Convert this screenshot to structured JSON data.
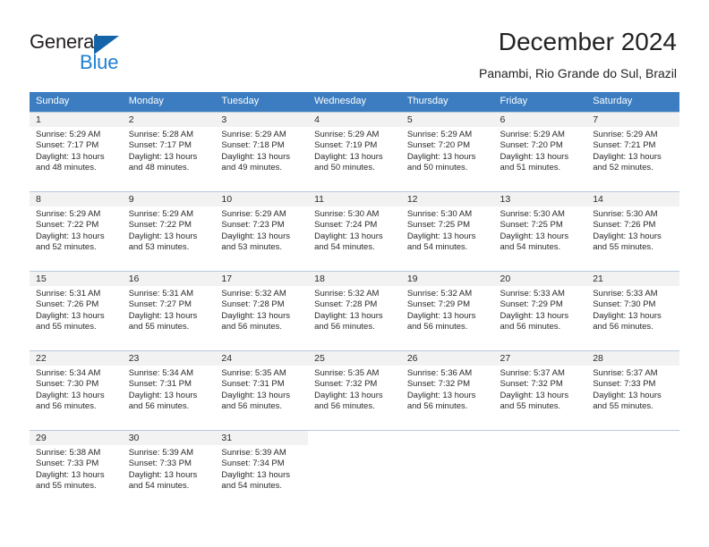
{
  "brand": {
    "name_part1": "General",
    "name_part2": "Blue",
    "accent_color": "#1f7fd4",
    "triangle_color": "#1464aa"
  },
  "header": {
    "title": "December 2024",
    "subtitle": "Panambi, Rio Grande do Sul, Brazil"
  },
  "calendar": {
    "header_bg": "#3b7dc0",
    "header_text_color": "#ffffff",
    "daynum_bg": "#f2f2f2",
    "weekdays": [
      "Sunday",
      "Monday",
      "Tuesday",
      "Wednesday",
      "Thursday",
      "Friday",
      "Saturday"
    ],
    "labels": {
      "sunrise": "Sunrise:",
      "sunset": "Sunset:",
      "daylight": "Daylight:"
    },
    "weeks": [
      [
        {
          "day": "1",
          "sunrise": "Sunrise: 5:29 AM",
          "sunset": "Sunset: 7:17 PM",
          "daylight1": "Daylight: 13 hours",
          "daylight2": "and 48 minutes."
        },
        {
          "day": "2",
          "sunrise": "Sunrise: 5:28 AM",
          "sunset": "Sunset: 7:17 PM",
          "daylight1": "Daylight: 13 hours",
          "daylight2": "and 48 minutes."
        },
        {
          "day": "3",
          "sunrise": "Sunrise: 5:29 AM",
          "sunset": "Sunset: 7:18 PM",
          "daylight1": "Daylight: 13 hours",
          "daylight2": "and 49 minutes."
        },
        {
          "day": "4",
          "sunrise": "Sunrise: 5:29 AM",
          "sunset": "Sunset: 7:19 PM",
          "daylight1": "Daylight: 13 hours",
          "daylight2": "and 50 minutes."
        },
        {
          "day": "5",
          "sunrise": "Sunrise: 5:29 AM",
          "sunset": "Sunset: 7:20 PM",
          "daylight1": "Daylight: 13 hours",
          "daylight2": "and 50 minutes."
        },
        {
          "day": "6",
          "sunrise": "Sunrise: 5:29 AM",
          "sunset": "Sunset: 7:20 PM",
          "daylight1": "Daylight: 13 hours",
          "daylight2": "and 51 minutes."
        },
        {
          "day": "7",
          "sunrise": "Sunrise: 5:29 AM",
          "sunset": "Sunset: 7:21 PM",
          "daylight1": "Daylight: 13 hours",
          "daylight2": "and 52 minutes."
        }
      ],
      [
        {
          "day": "8",
          "sunrise": "Sunrise: 5:29 AM",
          "sunset": "Sunset: 7:22 PM",
          "daylight1": "Daylight: 13 hours",
          "daylight2": "and 52 minutes."
        },
        {
          "day": "9",
          "sunrise": "Sunrise: 5:29 AM",
          "sunset": "Sunset: 7:22 PM",
          "daylight1": "Daylight: 13 hours",
          "daylight2": "and 53 minutes."
        },
        {
          "day": "10",
          "sunrise": "Sunrise: 5:29 AM",
          "sunset": "Sunset: 7:23 PM",
          "daylight1": "Daylight: 13 hours",
          "daylight2": "and 53 minutes."
        },
        {
          "day": "11",
          "sunrise": "Sunrise: 5:30 AM",
          "sunset": "Sunset: 7:24 PM",
          "daylight1": "Daylight: 13 hours",
          "daylight2": "and 54 minutes."
        },
        {
          "day": "12",
          "sunrise": "Sunrise: 5:30 AM",
          "sunset": "Sunset: 7:25 PM",
          "daylight1": "Daylight: 13 hours",
          "daylight2": "and 54 minutes."
        },
        {
          "day": "13",
          "sunrise": "Sunrise: 5:30 AM",
          "sunset": "Sunset: 7:25 PM",
          "daylight1": "Daylight: 13 hours",
          "daylight2": "and 54 minutes."
        },
        {
          "day": "14",
          "sunrise": "Sunrise: 5:30 AM",
          "sunset": "Sunset: 7:26 PM",
          "daylight1": "Daylight: 13 hours",
          "daylight2": "and 55 minutes."
        }
      ],
      [
        {
          "day": "15",
          "sunrise": "Sunrise: 5:31 AM",
          "sunset": "Sunset: 7:26 PM",
          "daylight1": "Daylight: 13 hours",
          "daylight2": "and 55 minutes."
        },
        {
          "day": "16",
          "sunrise": "Sunrise: 5:31 AM",
          "sunset": "Sunset: 7:27 PM",
          "daylight1": "Daylight: 13 hours",
          "daylight2": "and 55 minutes."
        },
        {
          "day": "17",
          "sunrise": "Sunrise: 5:32 AM",
          "sunset": "Sunset: 7:28 PM",
          "daylight1": "Daylight: 13 hours",
          "daylight2": "and 56 minutes."
        },
        {
          "day": "18",
          "sunrise": "Sunrise: 5:32 AM",
          "sunset": "Sunset: 7:28 PM",
          "daylight1": "Daylight: 13 hours",
          "daylight2": "and 56 minutes."
        },
        {
          "day": "19",
          "sunrise": "Sunrise: 5:32 AM",
          "sunset": "Sunset: 7:29 PM",
          "daylight1": "Daylight: 13 hours",
          "daylight2": "and 56 minutes."
        },
        {
          "day": "20",
          "sunrise": "Sunrise: 5:33 AM",
          "sunset": "Sunset: 7:29 PM",
          "daylight1": "Daylight: 13 hours",
          "daylight2": "and 56 minutes."
        },
        {
          "day": "21",
          "sunrise": "Sunrise: 5:33 AM",
          "sunset": "Sunset: 7:30 PM",
          "daylight1": "Daylight: 13 hours",
          "daylight2": "and 56 minutes."
        }
      ],
      [
        {
          "day": "22",
          "sunrise": "Sunrise: 5:34 AM",
          "sunset": "Sunset: 7:30 PM",
          "daylight1": "Daylight: 13 hours",
          "daylight2": "and 56 minutes."
        },
        {
          "day": "23",
          "sunrise": "Sunrise: 5:34 AM",
          "sunset": "Sunset: 7:31 PM",
          "daylight1": "Daylight: 13 hours",
          "daylight2": "and 56 minutes."
        },
        {
          "day": "24",
          "sunrise": "Sunrise: 5:35 AM",
          "sunset": "Sunset: 7:31 PM",
          "daylight1": "Daylight: 13 hours",
          "daylight2": "and 56 minutes."
        },
        {
          "day": "25",
          "sunrise": "Sunrise: 5:35 AM",
          "sunset": "Sunset: 7:32 PM",
          "daylight1": "Daylight: 13 hours",
          "daylight2": "and 56 minutes."
        },
        {
          "day": "26",
          "sunrise": "Sunrise: 5:36 AM",
          "sunset": "Sunset: 7:32 PM",
          "daylight1": "Daylight: 13 hours",
          "daylight2": "and 56 minutes."
        },
        {
          "day": "27",
          "sunrise": "Sunrise: 5:37 AM",
          "sunset": "Sunset: 7:32 PM",
          "daylight1": "Daylight: 13 hours",
          "daylight2": "and 55 minutes."
        },
        {
          "day": "28",
          "sunrise": "Sunrise: 5:37 AM",
          "sunset": "Sunset: 7:33 PM",
          "daylight1": "Daylight: 13 hours",
          "daylight2": "and 55 minutes."
        }
      ],
      [
        {
          "day": "29",
          "sunrise": "Sunrise: 5:38 AM",
          "sunset": "Sunset: 7:33 PM",
          "daylight1": "Daylight: 13 hours",
          "daylight2": "and 55 minutes."
        },
        {
          "day": "30",
          "sunrise": "Sunrise: 5:39 AM",
          "sunset": "Sunset: 7:33 PM",
          "daylight1": "Daylight: 13 hours",
          "daylight2": "and 54 minutes."
        },
        {
          "day": "31",
          "sunrise": "Sunrise: 5:39 AM",
          "sunset": "Sunset: 7:34 PM",
          "daylight1": "Daylight: 13 hours",
          "daylight2": "and 54 minutes."
        },
        {
          "day": "",
          "sunrise": "",
          "sunset": "",
          "daylight1": "",
          "daylight2": ""
        },
        {
          "day": "",
          "sunrise": "",
          "sunset": "",
          "daylight1": "",
          "daylight2": ""
        },
        {
          "day": "",
          "sunrise": "",
          "sunset": "",
          "daylight1": "",
          "daylight2": ""
        },
        {
          "day": "",
          "sunrise": "",
          "sunset": "",
          "daylight1": "",
          "daylight2": ""
        }
      ]
    ]
  }
}
